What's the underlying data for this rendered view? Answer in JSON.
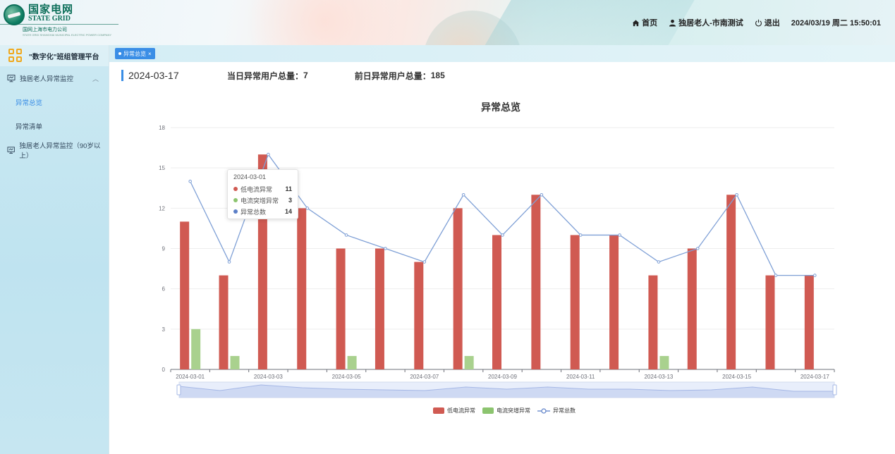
{
  "header": {
    "logo_cn": "国家电网",
    "logo_en": "STATE GRID",
    "logo_sub": "国网上海市电力公司",
    "logo_sub_en": "STATE GRID SHANGHAI MUNICIPAL ELECTRIC POWER COMPANY",
    "nav": {
      "home": "首页",
      "user": "独居老人-市南测试",
      "logout": "退出",
      "datetime": "2024/03/19 周二 15:50:01"
    }
  },
  "sidebar": {
    "title": "\"数字化\"班组管理平台",
    "groups": [
      {
        "label": "独居老人异常监控",
        "expanded": true
      },
      {
        "label": "独居老人异常监控（90岁以上）",
        "expanded": false
      }
    ],
    "items": [
      {
        "label": "异常总览",
        "active": true
      },
      {
        "label": "异常清单",
        "active": false
      }
    ]
  },
  "tabs": [
    {
      "label": "异常总览"
    }
  ],
  "summary": {
    "date": "2024-03-17",
    "today_label": "当日异常用户总量：",
    "today_value": "7",
    "prev_label": "前日异常用户总量：",
    "prev_value": "185"
  },
  "colors": {
    "low_current": "#d05a52",
    "surge": "#a9d18e",
    "total": "#7fa0d6",
    "accent": "#3a8ee6"
  },
  "chart_data": {
    "type": "bar",
    "title": "异常总览",
    "x": [
      "2024-03-01",
      "2024-03-02",
      "2024-03-03",
      "2024-03-04",
      "2024-03-05",
      "2024-03-06",
      "2024-03-07",
      "2024-03-08",
      "2024-03-09",
      "2024-03-10",
      "2024-03-11",
      "2024-03-12",
      "2024-03-13",
      "2024-03-14",
      "2024-03-15",
      "2024-03-16",
      "2024-03-17"
    ],
    "x_tick_labels": [
      "2024-03-01",
      "2024-03-03",
      "2024-03-05",
      "2024-03-07",
      "2024-03-09",
      "2024-03-11",
      "2024-03-13",
      "2024-03-15",
      "2024-03-17"
    ],
    "y_ticks": [
      0,
      3,
      6,
      9,
      12,
      15,
      18
    ],
    "ylim": [
      0,
      18
    ],
    "series": [
      {
        "name": "低电流异常",
        "type": "bar",
        "values": [
          11,
          7,
          16,
          12,
          9,
          9,
          8,
          12,
          10,
          13,
          10,
          10,
          7,
          9,
          13,
          7,
          7
        ]
      },
      {
        "name": "电流突增异常",
        "type": "bar",
        "values": [
          3,
          1,
          0,
          0,
          1,
          0,
          0,
          1,
          0,
          0,
          0,
          0,
          1,
          0,
          0,
          0,
          0
        ]
      },
      {
        "name": "异常总数",
        "type": "line",
        "values": [
          14,
          8,
          16,
          12,
          10,
          9,
          8,
          13,
          10,
          13,
          10,
          10,
          8,
          9,
          13,
          7,
          7
        ]
      }
    ],
    "legend_position": "bottom-center",
    "grid": true,
    "data_zoom": true,
    "tooltip": {
      "date": "2024-03-01",
      "rows": [
        {
          "name": "低电流异常",
          "value": "11"
        },
        {
          "name": "电流突增异常",
          "value": "3"
        },
        {
          "name": "异常总数",
          "value": "14"
        }
      ]
    }
  }
}
